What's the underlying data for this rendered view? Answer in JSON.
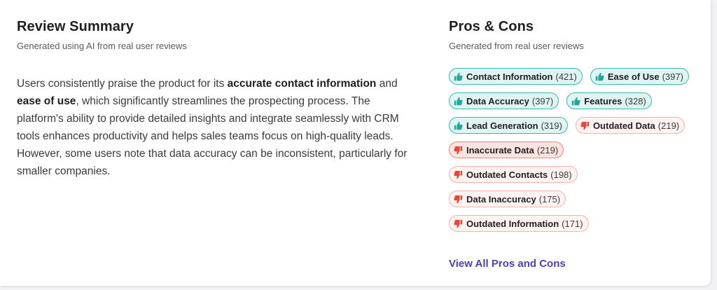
{
  "summary": {
    "title": "Review Summary",
    "subtitle": "Generated using AI from real user reviews",
    "text_parts": [
      {
        "text": "Users consistently praise the product for its ",
        "bold": false
      },
      {
        "text": "accurate contact information",
        "bold": true
      },
      {
        "text": " and ",
        "bold": false
      },
      {
        "text": "ease of use",
        "bold": true
      },
      {
        "text": ", which significantly streamlines the prospecting process. The platform's ability to provide detailed insights and integrate seamlessly with CRM tools enhances productivity and helps sales teams focus on high-quality leads. However, some users note that data accuracy can be inconsistent, particularly for smaller companies.",
        "bold": false
      }
    ]
  },
  "pros_cons": {
    "title": "Pros & Cons",
    "subtitle": "Generated from real user reviews",
    "view_all_label": "View All Pros and Cons",
    "rows": [
      [
        {
          "type": "pro",
          "label": "Contact Information",
          "count": "(421)"
        },
        {
          "type": "pro",
          "label": "Ease of Use",
          "count": "(397)"
        }
      ],
      [
        {
          "type": "pro",
          "label": "Data Accuracy",
          "count": "(397)"
        },
        {
          "type": "pro",
          "label": "Features",
          "count": "(328)"
        }
      ],
      [
        {
          "type": "pro",
          "label": "Lead Generation",
          "count": "(319)"
        },
        {
          "type": "con",
          "label": "Outdated Data",
          "count": "(219)"
        }
      ],
      [
        {
          "type": "con",
          "label": "Inaccurate Data",
          "count": "(219)",
          "active": true
        }
      ],
      [
        {
          "type": "con",
          "label": "Outdated Contacts",
          "count": "(198)"
        }
      ],
      [
        {
          "type": "con",
          "label": "Data Inaccuracy",
          "count": "(175)"
        }
      ],
      [
        {
          "type": "con",
          "label": "Outdated Information",
          "count": "(171)"
        }
      ]
    ]
  },
  "colors": {
    "pro_icon": "#27a69a",
    "con_icon": "#e2483a",
    "link": "#4f3fb3"
  },
  "icons": {
    "pro": "thumbs-up-icon",
    "con": "thumbs-down-icon"
  }
}
